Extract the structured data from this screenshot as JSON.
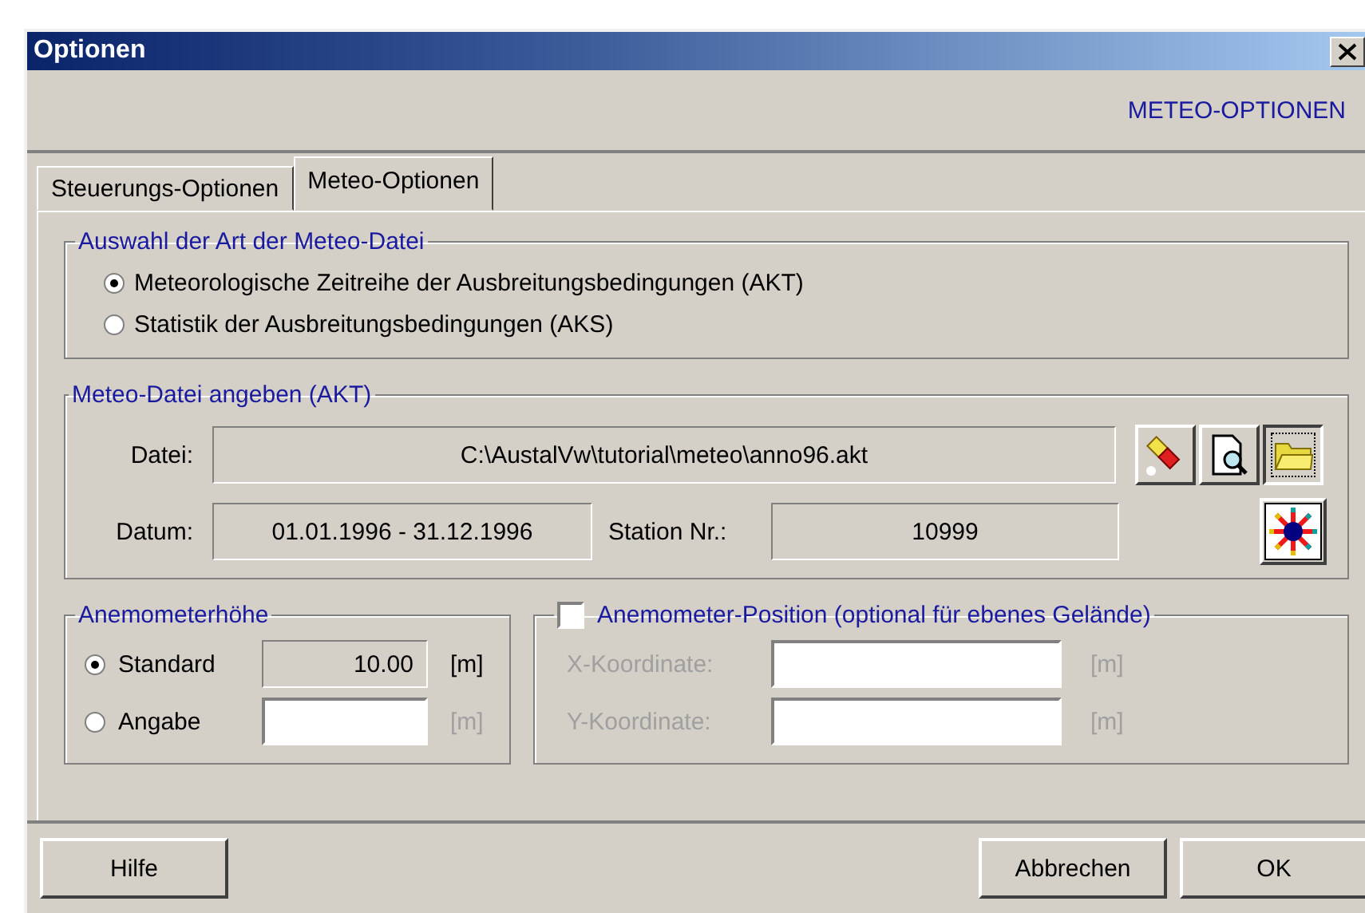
{
  "window": {
    "title": "Optionen"
  },
  "header": "METEO-OPTIONEN",
  "tabs": [
    {
      "label": "Steuerungs-Optionen",
      "selected": false
    },
    {
      "label": "Meteo-Optionen",
      "selected": true
    }
  ],
  "file_type": {
    "legend": "Auswahl der Art der Meteo-Datei",
    "options": [
      {
        "label": "Meteorologische Zeitreihe der Ausbreitungsbedingungen (AKT)",
        "selected": true
      },
      {
        "label": "Statistik der Ausbreitungsbedingungen (AKS)",
        "selected": false
      }
    ]
  },
  "meteo_file": {
    "legend": "Meteo-Datei angeben (AKT)",
    "file_label": "Datei:",
    "file_value": "C:\\AustalVw\\tutorial\\meteo\\anno96.akt",
    "date_label": "Datum:",
    "date_value": "01.01.1996 - 31.12.1996",
    "station_label": "Station Nr.:",
    "station_value": "10999"
  },
  "height": {
    "legend": "Anemometerhöhe",
    "options": [
      {
        "label": "Standard",
        "selected": true,
        "value": "10.00",
        "readonly": true,
        "unit": "[m]"
      },
      {
        "label": "Angabe",
        "selected": false,
        "readonly": false,
        "unit": "[m]"
      }
    ]
  },
  "position": {
    "label": "Anemometer-Position (optional für ebenes Gelände)",
    "checked": false,
    "fields": [
      {
        "label": "X-Koordinate:",
        "unit": "[m]"
      },
      {
        "label": "Y-Koordinate:",
        "unit": "[m]"
      }
    ]
  },
  "buttons": [
    {
      "label": "Hilfe"
    },
    {
      "label": "Abbrechen"
    },
    {
      "label": "OK"
    }
  ]
}
